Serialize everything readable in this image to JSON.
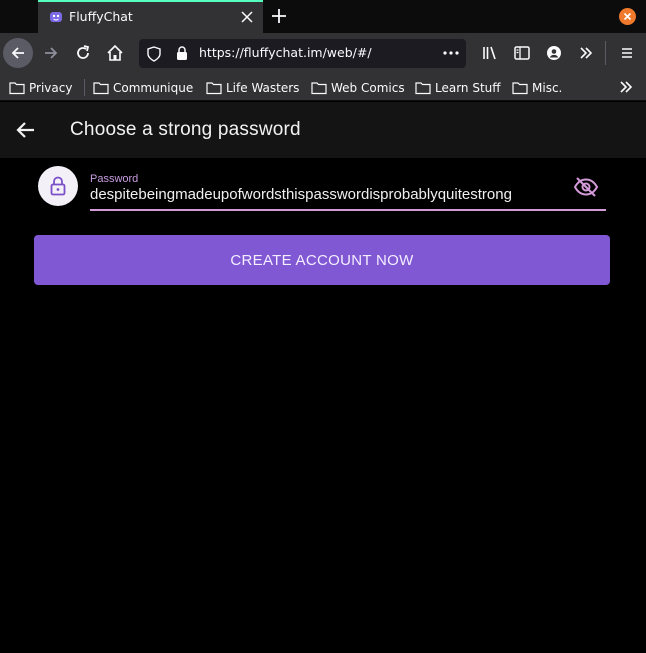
{
  "browser": {
    "tab": {
      "title": "FluffyChat",
      "favicon": "fluffychat-icon"
    },
    "url": "https://fluffychat.im/web/#/",
    "bookmarks": [
      "Privacy",
      "Communique",
      "Life Wasters",
      "Web Comics",
      "Learn Stuff",
      "Misc."
    ]
  },
  "app": {
    "title": "Choose a strong password",
    "password_field": {
      "label": "Password",
      "value": "despitebeingmadeupofwordsthispasswordisprobablyquitestrong"
    },
    "create_button": "CREATE ACCOUNT NOW"
  },
  "colors": {
    "accent": "#8058d4",
    "field_underline": "#d39ad8",
    "tab_highlight": "#54ffbd"
  }
}
